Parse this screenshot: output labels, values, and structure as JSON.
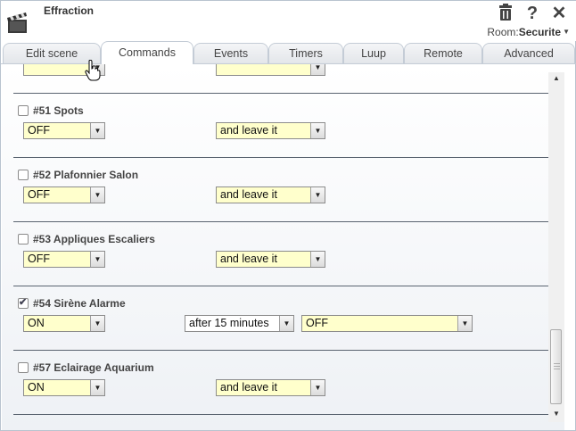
{
  "header": {
    "title": "Effraction",
    "room_label": "Room:",
    "room_value": "Securite"
  },
  "tabs": [
    {
      "label": "Edit scene"
    },
    {
      "label": "Commands"
    },
    {
      "label": "Events"
    },
    {
      "label": "Timers"
    },
    {
      "label": "Luup"
    },
    {
      "label": "Remote"
    },
    {
      "label": "Advanced"
    }
  ],
  "active_tab": "Commands",
  "devices": [
    {
      "name": "#51 Spots",
      "checked": false,
      "state": "OFF",
      "action": "and leave it"
    },
    {
      "name": "#52 Plafonnier Salon",
      "checked": false,
      "state": "OFF",
      "action": "and leave it"
    },
    {
      "name": "#53 Appliques Escaliers",
      "checked": false,
      "state": "OFF",
      "action": "and leave it"
    },
    {
      "name": "#54 Sirène Alarme",
      "checked": true,
      "state": "ON",
      "delay": "after 15 minutes",
      "then": "OFF"
    },
    {
      "name": "#57 Eclairage Aquarium",
      "checked": false,
      "state": "ON",
      "action": "and leave it"
    }
  ],
  "icons": {
    "app": "clapperboard-icon",
    "delete": "trash-icon",
    "help": "question-icon",
    "close": "close-icon"
  },
  "colors": {
    "select_bg": "#ffffcc",
    "rule": "#5a6470",
    "tab_border": "#c4ccd6"
  }
}
